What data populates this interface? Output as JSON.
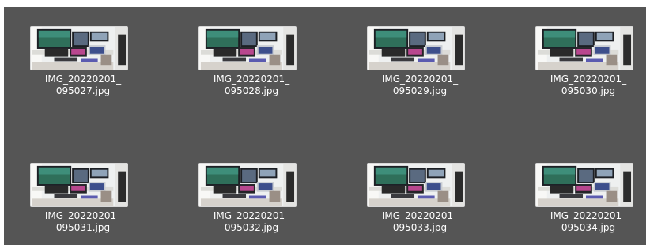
{
  "files": [
    {
      "name": "IMG_20220201_\n095027.jpg"
    },
    {
      "name": "IMG_20220201_\n095028.jpg"
    },
    {
      "name": "IMG_20220201_\n095029.jpg"
    },
    {
      "name": "IMG_20220201_\n095030.jpg"
    },
    {
      "name": "IMG_20220201_\n095031.jpg"
    },
    {
      "name": "IMG_20220201_\n095032.jpg"
    },
    {
      "name": "IMG_20220201_\n095033.jpg"
    },
    {
      "name": "IMG_20220201_\n095034.jpg"
    }
  ],
  "colors": {
    "background": "#555555",
    "text": "#ffffff",
    "thumb_border": "#d8d8d8"
  }
}
